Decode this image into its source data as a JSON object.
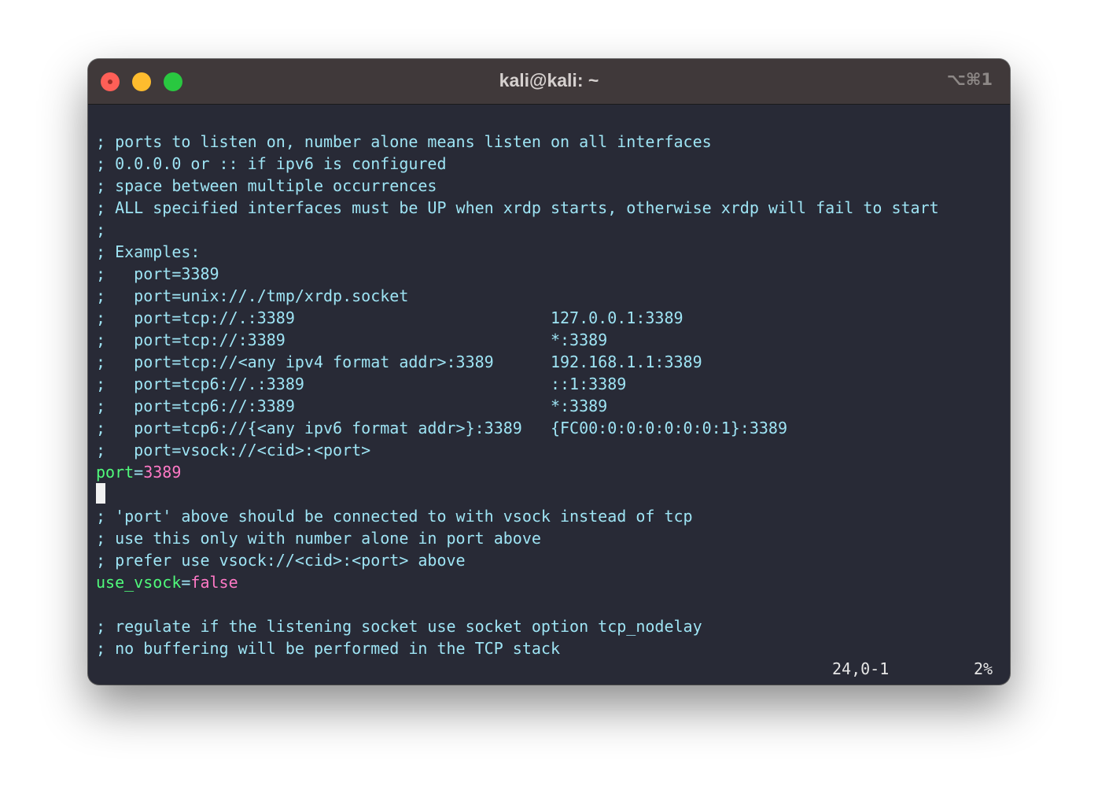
{
  "window": {
    "title": "kali@kali: ~",
    "shortcut": "⌥⌘1"
  },
  "colors": {
    "background": "#282a36",
    "titlebar": "#40393a",
    "comment": "#9ee4f4",
    "key": "#50fa7b",
    "value": "#ff79c6",
    "status": "#e6e6e6"
  },
  "editor": {
    "lines": [
      {
        "type": "comment",
        "text": "; ports to listen on, number alone means listen on all interfaces"
      },
      {
        "type": "comment",
        "text": "; 0.0.0.0 or :: if ipv6 is configured"
      },
      {
        "type": "comment",
        "text": "; space between multiple occurrences"
      },
      {
        "type": "comment",
        "text": "; ALL specified interfaces must be UP when xrdp starts, otherwise xrdp will fail to start"
      },
      {
        "type": "comment",
        "text": ";"
      },
      {
        "type": "comment",
        "text": "; Examples:"
      },
      {
        "type": "comment",
        "text": ";   port=3389"
      },
      {
        "type": "comment",
        "text": ";   port=unix://./tmp/xrdp.socket"
      },
      {
        "type": "comment",
        "text": ";   port=tcp://.:3389                           127.0.0.1:3389"
      },
      {
        "type": "comment",
        "text": ";   port=tcp://:3389                            *:3389"
      },
      {
        "type": "comment",
        "text": ";   port=tcp://<any ipv4 format addr>:3389      192.168.1.1:3389"
      },
      {
        "type": "comment",
        "text": ";   port=tcp6://.:3389                          ::1:3389"
      },
      {
        "type": "comment",
        "text": ";   port=tcp6://:3389                           *:3389"
      },
      {
        "type": "comment",
        "text": ";   port=tcp6://{<any ipv6 format addr>}:3389   {FC00:0:0:0:0:0:0:1}:3389"
      },
      {
        "type": "comment",
        "text": ";   port=vsock://<cid>:<port>"
      },
      {
        "type": "kv",
        "key": "port",
        "sep": "=",
        "value": "3389"
      },
      {
        "type": "cursor"
      },
      {
        "type": "comment",
        "text": "; 'port' above should be connected to with vsock instead of tcp"
      },
      {
        "type": "comment",
        "text": "; use this only with number alone in port above"
      },
      {
        "type": "comment",
        "text": "; prefer use vsock://<cid>:<port> above"
      },
      {
        "type": "kv",
        "key": "use_vsock",
        "sep": "=",
        "value": "false"
      },
      {
        "type": "blank"
      },
      {
        "type": "comment",
        "text": "; regulate if the listening socket use socket option tcp_nodelay"
      },
      {
        "type": "comment",
        "text": "; no buffering will be performed in the TCP stack"
      }
    ]
  },
  "statusline": {
    "position": "24,0-1",
    "percent": "2%"
  }
}
